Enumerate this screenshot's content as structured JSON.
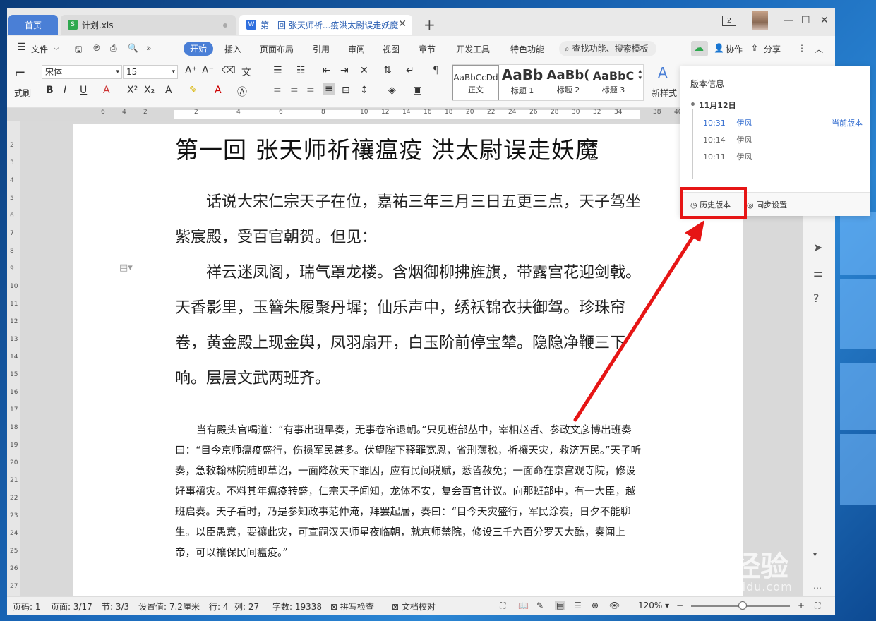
{
  "tabs": {
    "home": "首页",
    "xls": "计划.xls",
    "doc": "第一回 张天师祈...疫洪太尉误走妖魔",
    "counter": "2"
  },
  "menu": {
    "file": "文件",
    "start": "开始",
    "insert": "插入",
    "layout": "页面布局",
    "reference": "引用",
    "review": "审阅",
    "view": "视图",
    "chapter": "章节",
    "devtools": "开发工具",
    "special": "特色功能",
    "search": "查找功能、搜索模板",
    "collab": "协作",
    "share": "分享"
  },
  "ribbon": {
    "font_name": "宋体",
    "font_size": "15",
    "format_painter": "式刷",
    "new_style": "新样式",
    "styles": [
      {
        "sample": "AaBbCcDd",
        "label": "正文"
      },
      {
        "sample": "AaBb",
        "label": "标题 1"
      },
      {
        "sample": "AaBb(",
        "label": "标题 2"
      },
      {
        "sample": "AaBbC",
        "label": "标题 3"
      }
    ]
  },
  "document": {
    "title": "第一回  张天师祈禳瘟疫    洪太尉误走妖魔",
    "para1": "话说大宋仁宗天子在位，嘉祐三年三月三日五更三点，天子驾坐紫宸殿，受百官朝贺。但见：",
    "para2": "祥云迷凤阁，瑞气罩龙楼。含烟御柳拂旌旗，带露宫花迎剑戟。天香影里，玉簪朱履聚丹墀；仙乐声中，绣袄锦衣扶御驾。珍珠帘卷，黄金殿上现金舆，凤羽扇开，白玉阶前停宝辇。隐隐净鞭三下响。层层文武两班齐。",
    "para3": "当有殿头官喝道：“有事出班早奏，无事卷帘退朝。”只见班部丛中，宰相赵哲、参政文彦博出班奏曰：“目今京师瘟疫盛行，伤损军民甚多。伏望陛下释罪宽恩，省刑薄税，祈禳天灾，救济万民。”天子听奏，急敕翰林院随即草诏，一面降赦天下罪囚，应有民间税赋，悉皆赦免；一面命在京宫观寺院，修设好事禳灾。不料其年瘟疫转盛，仁宗天子闻知，龙体不安，复会百官计议。向那班部中，有一大臣，越班启奏。天子看时，乃是参知政事范仲淹，拜罢起居，奏曰：“目今天灾盛行，军民涂炭，日夕不能聊生。以臣愚意，要禳此灾，可宣嗣汉天师星夜临朝，就京师禁院，修设三千六百分罗天大醮，奏闻上帝，可以禳保民间瘟疫。”"
  },
  "version_panel": {
    "title": "版本信息",
    "date": "11月12日",
    "entries": [
      {
        "time": "10:31",
        "user": "伊风",
        "tag": "当前版本"
      },
      {
        "time": "10:14",
        "user": "伊风"
      },
      {
        "time": "10:11",
        "user": "伊风"
      }
    ],
    "history_btn": "历史版本",
    "sync_btn": "同步设置"
  },
  "status": {
    "page_no": "页码: 1",
    "page": "页面: 3/17",
    "section": "节: 3/3",
    "setting": "设置值: 7.2厘米",
    "row": "行: 4",
    "col": "列: 27",
    "words": "字数: 19338",
    "spell": "拼写检查",
    "proof": "文档校对",
    "zoom": "120%"
  },
  "watermark": {
    "main": "Bai 经验",
    "sub": "jingyan.baidu.com"
  },
  "colors": {
    "accent": "#4a7fd6",
    "link": "#3a72d1",
    "highlight": "#e61515"
  }
}
